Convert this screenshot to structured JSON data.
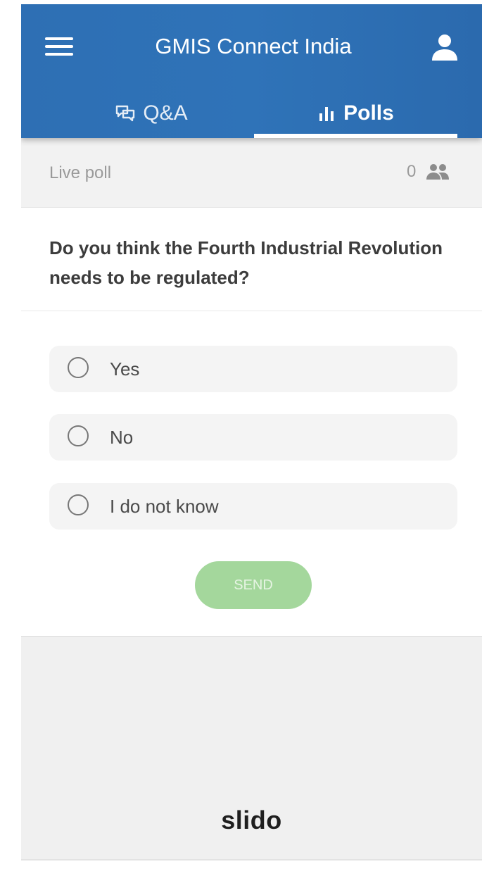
{
  "header": {
    "title": "GMIS Connect India",
    "menu_icon": "hamburger-menu-icon",
    "profile_icon": "user-profile-icon",
    "background_color": "#2e6fb4"
  },
  "tabs": [
    {
      "label": "Q&A",
      "icon": "speech-bubbles-icon",
      "active": false
    },
    {
      "label": "Polls",
      "icon": "bar-chart-icon",
      "active": true
    }
  ],
  "poll": {
    "status_label": "Live poll",
    "participant_count": "0",
    "participants_icon": "people-icon",
    "question": "Do you think the Fourth Industrial Revolution needs to be regulated?",
    "options": [
      {
        "label": "Yes",
        "selected": false
      },
      {
        "label": "No",
        "selected": false
      },
      {
        "label": "I do not know",
        "selected": false
      }
    ],
    "send_label": "SEND",
    "send_color": "#a4d79c"
  },
  "footer": {
    "brand": "slido"
  }
}
